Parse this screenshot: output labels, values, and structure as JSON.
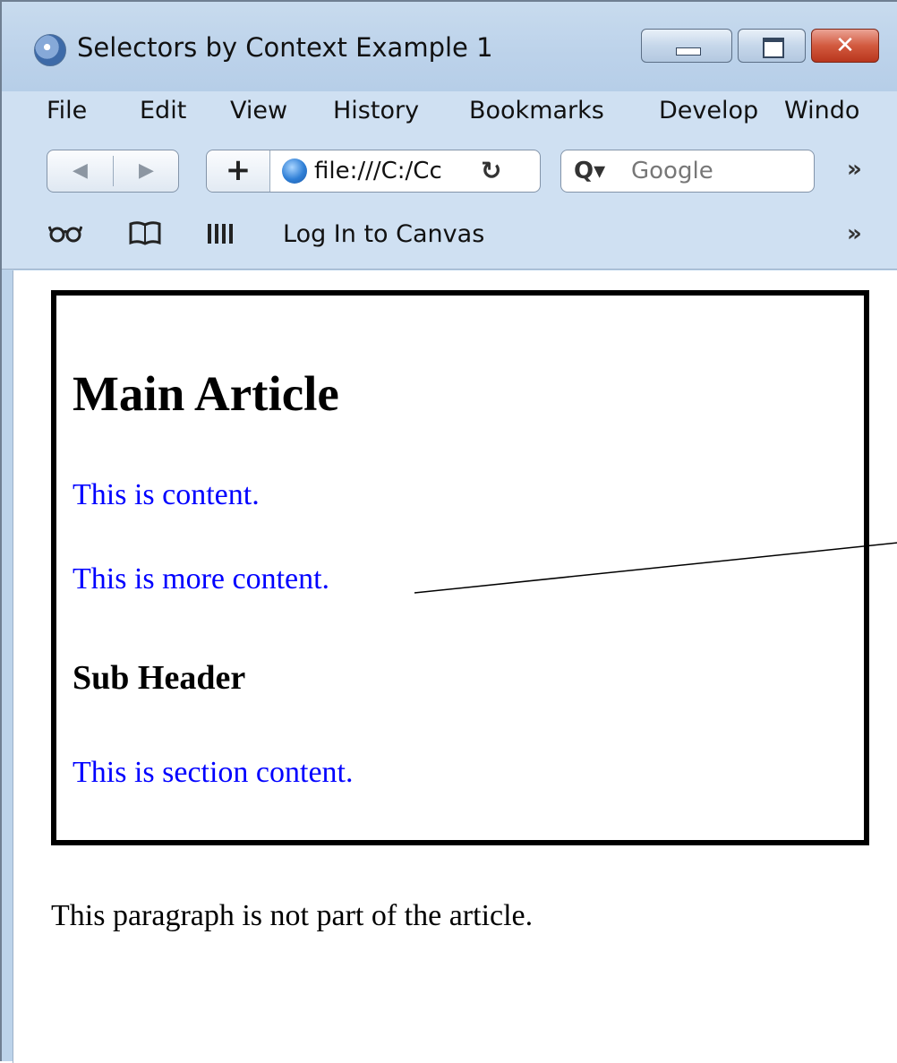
{
  "window": {
    "title": "Selectors by Context Example 1",
    "close_label": "✕"
  },
  "menu": [
    "File",
    "Edit",
    "View",
    "History",
    "Bookmarks",
    "Develop",
    "Windo"
  ],
  "toolbar": {
    "back_icon": "◀",
    "forward_icon": "▶",
    "new_tab_label": "+",
    "url": "file:///C:/Cc",
    "reload_icon": "↻",
    "search_icon": "Q▾",
    "search_placeholder": "Google",
    "overflow_icon": "»"
  },
  "bookmarks": {
    "glasses_icon": "ഗ",
    "book_icon": "📖",
    "link": "Log In to Canvas",
    "overflow_icon": "»"
  },
  "page": {
    "heading": "Main Article",
    "paragraphs": [
      "This is content.",
      "This is more content."
    ],
    "subheading": "Sub Header",
    "section_paragraph": "This is section content.",
    "outside_paragraph": "This paragraph is not part of the article."
  },
  "colors": {
    "article_text": "#0000ff",
    "border": "#000000",
    "chrome": "#cfe0f2"
  }
}
